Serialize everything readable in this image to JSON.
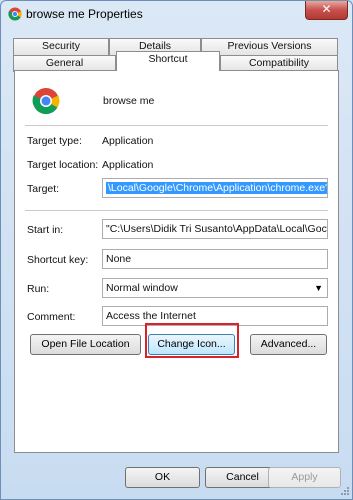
{
  "window": {
    "title": "browse me Properties",
    "close_glyph": "✕"
  },
  "tabs": {
    "back": [
      "Security",
      "Details",
      "Previous Versions"
    ],
    "front": [
      "General",
      "Shortcut",
      "Compatibility"
    ],
    "active": "Shortcut"
  },
  "shortcut": {
    "app_name": "browse me",
    "app_icon": "chrome-icon",
    "target_type_label": "Target type:",
    "target_type_value": "Application",
    "target_location_label": "Target location:",
    "target_location_value": "Application",
    "target_label": "Target:",
    "target_value": "\\Local\\Google\\Chrome\\Application\\chrome.exe\"",
    "start_in_label": "Start in:",
    "start_in_value": "\"C:\\Users\\Didik Tri Susanto\\AppData\\Local\\Goc",
    "shortcut_key_label": "Shortcut key:",
    "shortcut_key_value": "None",
    "run_label": "Run:",
    "run_value": "Normal window",
    "comment_label": "Comment:",
    "comment_value": "Access the Internet",
    "open_file_location": "Open File Location",
    "change_icon": "Change Icon...",
    "advanced": "Advanced..."
  },
  "footer": {
    "ok": "OK",
    "cancel": "Cancel",
    "apply": "Apply"
  },
  "colors": {
    "selection": "#3399ff",
    "highlight_box": "#d9232a",
    "close_button": "#c75050"
  }
}
